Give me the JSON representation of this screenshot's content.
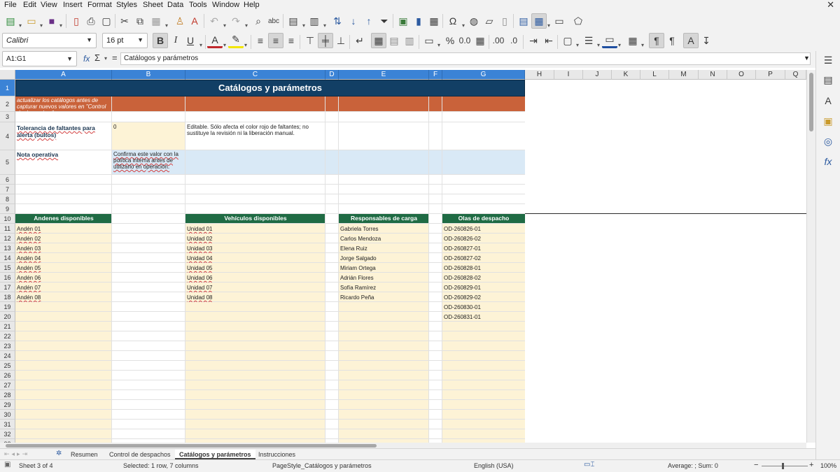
{
  "menu": [
    "File",
    "Edit",
    "View",
    "Insert",
    "Format",
    "Styles",
    "Sheet",
    "Data",
    "Tools",
    "Window",
    "Help"
  ],
  "window_close": "✕",
  "font": {
    "name": "Calibri",
    "size": "16 pt"
  },
  "name_box": "A1:G1",
  "formula": {
    "fx": "fx",
    "sum": "Σ",
    "eq": "=",
    "content": "Catálogos y parámetros"
  },
  "columns": [
    "A",
    "B",
    "C",
    "D",
    "E",
    "F",
    "G",
    "H",
    "I",
    "J",
    "K",
    "L",
    "M",
    "N",
    "O",
    "P",
    "Q"
  ],
  "rows": [
    "1",
    "2",
    "3",
    "4",
    "5",
    "6",
    "7",
    "8",
    "9",
    "10",
    "11",
    "12",
    "13",
    "14",
    "15",
    "16",
    "17",
    "18",
    "19",
    "20",
    "21",
    "22",
    "23",
    "24",
    "25",
    "26",
    "27",
    "28",
    "29",
    "30",
    "31",
    "32",
    "33"
  ],
  "sheet": {
    "title": "Catálogos y parámetros",
    "row2_note": "actualizar los catálogos antes de capturar nuevos valores en \"Control de despachos\".",
    "tolerance_label": "Tolerancia de faltantes para alerta (bultos)",
    "tolerance_value": "0",
    "tolerance_note": "Editable. Sólo afecta el color rojo de faltantes; no sustituye la revisión ni la liberación manual.",
    "note_label": "Nota operativa",
    "note_value": "Confirma este valor con la política interna antes de utilizarlo en operación.",
    "lists": {
      "andenes": {
        "header": "Andenes disponibles",
        "items": [
          "Andén 01",
          "Andén 02",
          "Andén 03",
          "Andén 04",
          "Andén 05",
          "Andén 06",
          "Andén 07",
          "Andén 08"
        ]
      },
      "vehiculos": {
        "header": "Vehículos disponibles",
        "items": [
          "Unidad 01",
          "Unidad 02",
          "Unidad 03",
          "Unidad 04",
          "Unidad 05",
          "Unidad 06",
          "Unidad 07",
          "Unidad 08"
        ]
      },
      "responsables": {
        "header": "Responsables de carga",
        "items": [
          "Gabriela Torres",
          "Carlos Mendoza",
          "Elena Ruiz",
          "Jorge Salgado",
          "Miriam Ortega",
          "Adrián Flores",
          "Sofía Ramírez",
          "Ricardo Peña"
        ]
      },
      "olas": {
        "header": "Olas de despacho",
        "items": [
          "OD-260826-01",
          "OD-260826-02",
          "OD-260827-01",
          "OD-260827-02",
          "OD-260828-01",
          "OD-260828-02",
          "OD-260829-01",
          "OD-260829-02",
          "OD-260830-01",
          "OD-260831-01"
        ]
      }
    }
  },
  "tabs": [
    "Resumen",
    "Control de despachos",
    "Catálogos y parámetros",
    "Instrucciones"
  ],
  "active_tab": "Catálogos y parámetros",
  "status": {
    "sheet": "Sheet 3 of 4",
    "selection": "Selected: 1 row, 7 columns",
    "page_style": "PageStyle_Catálogos y parámetros",
    "language": "English (USA)",
    "stats": "Average: ; Sum: 0",
    "zoom": "100%"
  },
  "colors": {
    "title_bg": "#123f65",
    "orange": "#c9623a",
    "green": "#1f6b44",
    "cream": "#fdf3d6",
    "blue": "#d9e9f6",
    "selection": "#3b83d6"
  }
}
